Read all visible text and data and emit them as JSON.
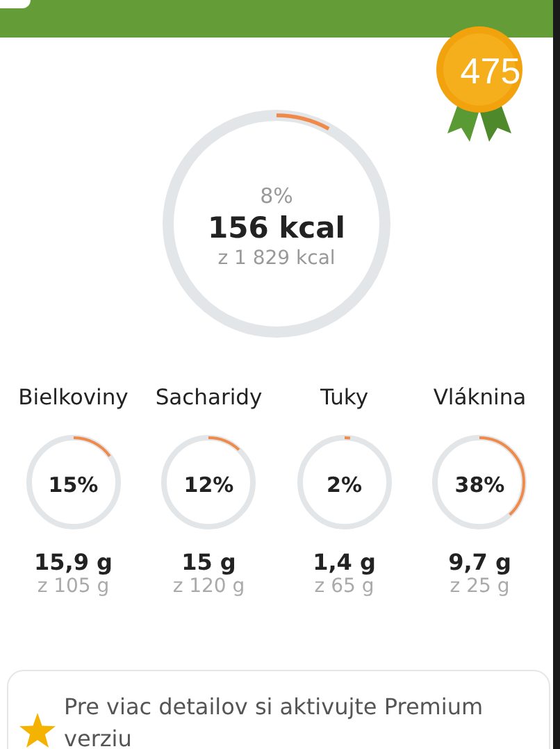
{
  "badge": {
    "value": "475"
  },
  "calories": {
    "percent": "8%",
    "level": 0.08,
    "value": "156 kcal",
    "goal": "z 1 829 kcal"
  },
  "nutrients": [
    {
      "name": "Bielkoviny",
      "percent": "15%",
      "level": 0.15,
      "value": "15,9 g",
      "goal": "z 105 g"
    },
    {
      "name": "Sacharidy",
      "percent": "12%",
      "level": 0.12,
      "value": "15 g",
      "goal": "z 120 g"
    },
    {
      "name": "Tuky",
      "percent": "2%",
      "level": 0.02,
      "value": "1,4 g",
      "goal": "z 65 g"
    },
    {
      "name": "Vláknina",
      "percent": "38%",
      "level": 0.38,
      "value": "9,7 g",
      "goal": "z 25 g"
    }
  ],
  "premium_note": {
    "text": "Pre viac detailov si aktivujte Premium verziu"
  }
}
